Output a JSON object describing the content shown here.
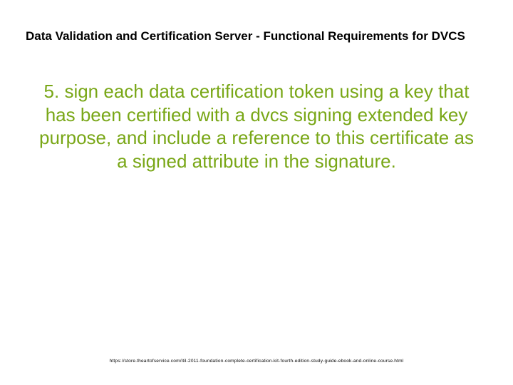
{
  "title": "Data Validation and Certification Server - Functional Requirements for DVCS",
  "body": "5. sign each data certification token using a key that has been certified with a dvcs signing extended key purpose, and include a reference to this certificate as a signed attribute in the signature.",
  "footer": "https://store.theartofservice.com/itil-2011-foundation-complete-certification-kit-fourth-edition-study-guide-ebook-and-online-course.html"
}
